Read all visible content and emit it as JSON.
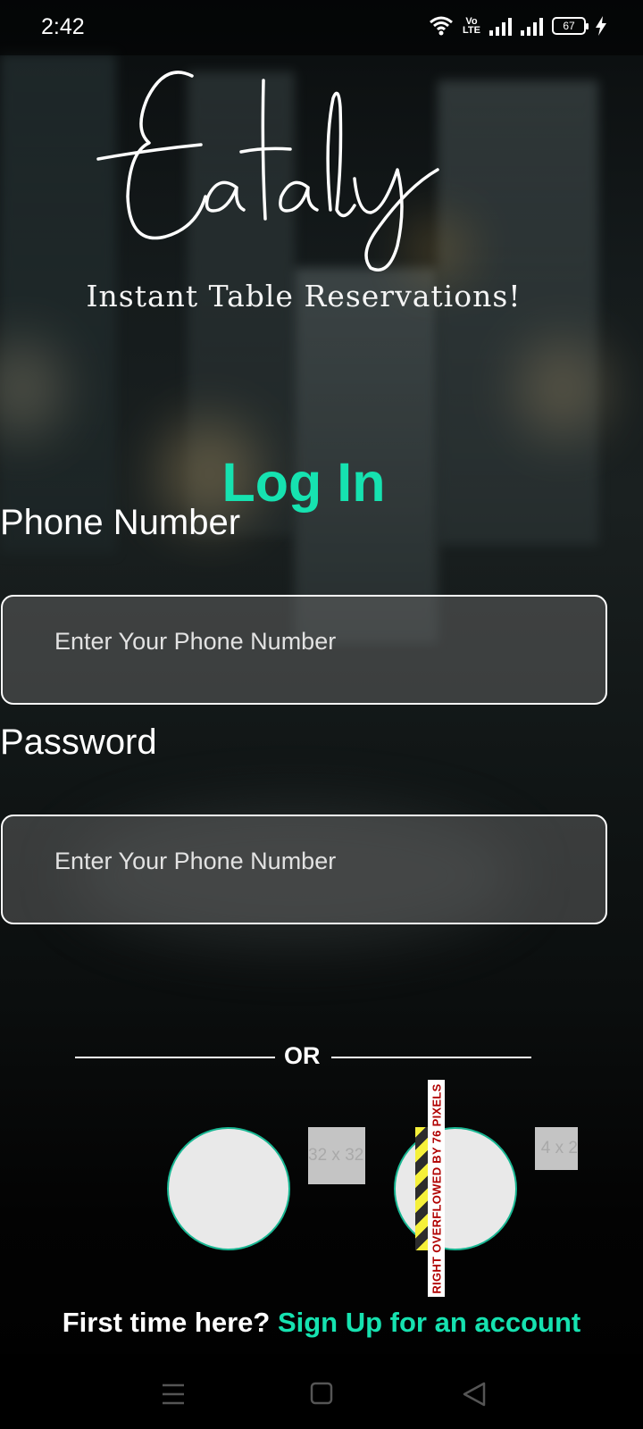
{
  "status_bar": {
    "time": "2:42",
    "battery": "67",
    "network_badge": "VoD LTE2"
  },
  "brand": {
    "logo_text": "Eataly",
    "tagline": "Instant Table Reservations!"
  },
  "form": {
    "title": "Log In",
    "phone": {
      "label": "Phone Number",
      "placeholder": "Enter Your Phone Number",
      "value": ""
    },
    "password": {
      "label": "Password",
      "placeholder": "Enter Your Phone Number",
      "value": ""
    }
  },
  "divider": {
    "text": "OR"
  },
  "social": {
    "placeholder_1": "32 x 32",
    "placeholder_2": "4 x 2",
    "overflow_warning": "RIGHT OVERFLOWED BY 76 PIXELS"
  },
  "footer": {
    "prompt": "First time here? ",
    "signup_link": "Sign Up for an account"
  },
  "colors": {
    "accent": "#16e2b0",
    "field_border": "#ffffff",
    "circle_border": "#19b793"
  },
  "nav_icons": [
    "menu-icon",
    "home-square-icon",
    "back-triangle-icon"
  ]
}
